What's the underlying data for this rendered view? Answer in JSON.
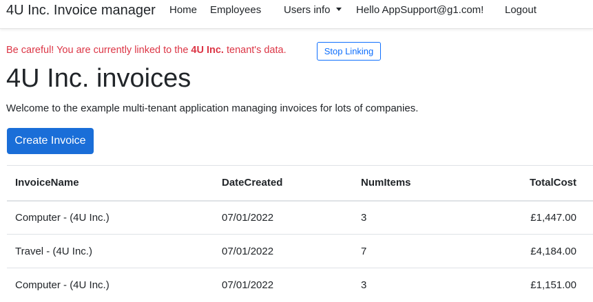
{
  "navbar": {
    "brand": "4U Inc. Invoice manager",
    "links": [
      {
        "label": "Home"
      },
      {
        "label": "Employees"
      },
      {
        "label": "Users info"
      },
      {
        "label": "Hello AppSupport@g1.com!"
      },
      {
        "label": "Logout"
      }
    ]
  },
  "warning": {
    "prefix": "Be careful! You are currently linked to the ",
    "tenant": "4U Inc.",
    "suffix": " tenant's data.",
    "stop_button": "Stop Linking",
    "color": "#dc3545"
  },
  "page": {
    "title": "4U Inc. invoices",
    "welcome": "Welcome to the example multi-tenant application managing invoices for lots of companies.",
    "create_button": "Create Invoice",
    "accent": "#1a6ed8"
  },
  "table": {
    "headers": [
      "InvoiceName",
      "DateCreated",
      "NumItems",
      "TotalCost"
    ],
    "rows": [
      [
        "Computer - (4U Inc.)",
        "07/01/2022",
        "3",
        "£1,447.00"
      ],
      [
        "Travel - (4U Inc.)",
        "07/01/2022",
        "7",
        "£4,184.00"
      ],
      [
        "Computer - (4U Inc.)",
        "07/01/2022",
        "3",
        "£1,151.00"
      ]
    ]
  }
}
